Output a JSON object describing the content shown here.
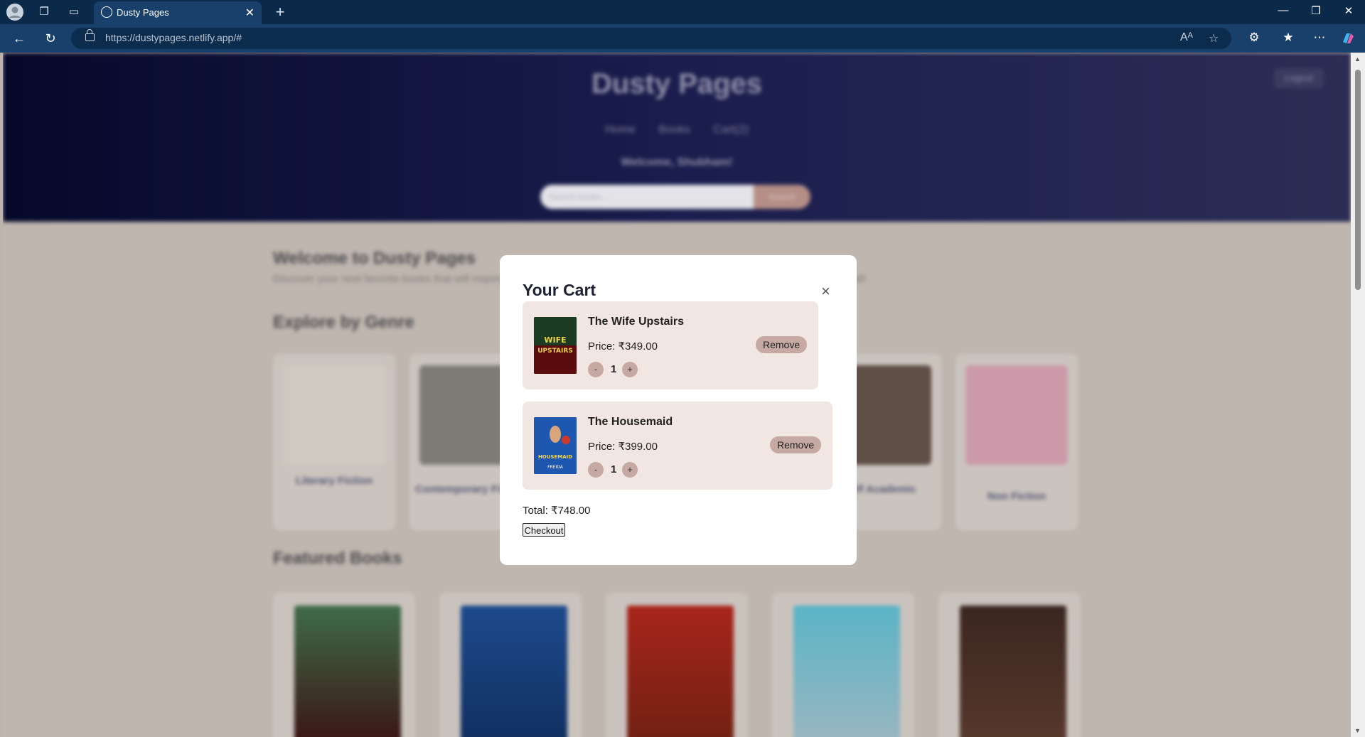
{
  "browser": {
    "tab_title": "Dusty Pages",
    "url_host": "https://dustypages.netlify.app",
    "url_path": "/#"
  },
  "header": {
    "site_title": "Dusty Pages",
    "logout": "Logout",
    "nav": [
      "Home",
      "Books",
      "Cart(2)"
    ],
    "welcome": "Welcome, Shubham!",
    "search_placeholder": "Search books...",
    "search_button": "Search"
  },
  "main": {
    "welcome_heading": "Welcome to Dusty Pages",
    "intro": "Discover your next favorite books that will inspire — from the greatest literary masterpieces to gripping thrillers - we have it all!",
    "genre_heading": "Explore by Genre",
    "genres": [
      "Literary Fiction",
      "Contemporary Fiction",
      "",
      "",
      "Self Academic",
      "Non Fiction"
    ],
    "featured_heading": "Featured Books"
  },
  "cart": {
    "title": "Your Cart",
    "close": "×",
    "items": [
      {
        "title": "The Wife Upstairs",
        "price": "Price: ₹349.00",
        "qty": "1",
        "remove": "Remove",
        "minus": "-",
        "plus": "+"
      },
      {
        "title": "The Housemaid",
        "price": "Price: ₹399.00",
        "qty": "1",
        "remove": "Remove",
        "minus": "-",
        "plus": "+"
      }
    ],
    "total": "Total: ₹748.00",
    "checkout": "Checkout"
  },
  "colors": {
    "accent": "#c7a9a4",
    "item_bg": "#f1e6e1",
    "hero_dark": "#06082a"
  }
}
